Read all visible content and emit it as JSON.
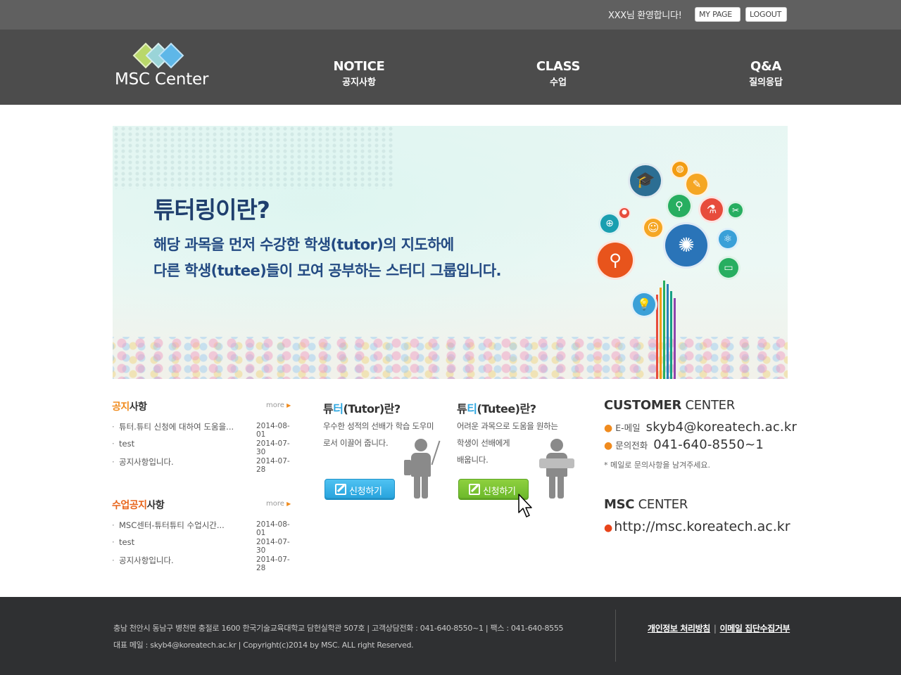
{
  "topbar": {
    "welcome": "XXX님 환영합니다!",
    "mypage_label": "MY PAGE",
    "logout_label": "LOGOUT"
  },
  "header": {
    "logo_text": "MSC Center",
    "nav": [
      {
        "en": "NOTICE",
        "ko": "공지사항"
      },
      {
        "en": "CLASS",
        "ko": "수업"
      },
      {
        "en": "Q&A",
        "ko": "질의응답"
      }
    ]
  },
  "banner": {
    "title": "튜터링이란?",
    "line1": "해당 과목을 먼저 수강한 학생(tutor)의 지도하에",
    "line2": "다른 학생(tutee)들이 모여 공부하는 스터디 그룹입니다."
  },
  "notice": {
    "title_hl": "공지",
    "title_rest": "사항",
    "more_label": "more",
    "items": [
      {
        "text": "튜터.튜티 신청에 대하여 도움을...",
        "date": "2014-08-01"
      },
      {
        "text": "test",
        "date": "2014-07-30"
      },
      {
        "text": "공지사항입니다.",
        "date": "2014-07-28"
      }
    ]
  },
  "class_notice": {
    "title_hl": "수업공지",
    "title_rest": "사항",
    "more_label": "more",
    "items": [
      {
        "text": "MSC센터-튜터튜티 수업시간...",
        "date": "2014-08-01"
      },
      {
        "text": "test",
        "date": "2014-07-30"
      },
      {
        "text": "공지사항입니다.",
        "date": "2014-07-28"
      }
    ]
  },
  "tutor": {
    "title_pre": "튜",
    "title_hl": "터",
    "title_rest": "(Tutor)란?",
    "desc1": "우수한 성적의 선배가 학습 도우미",
    "desc2": "로서 이끌어 줍니다.",
    "button": "신청하기"
  },
  "tutee": {
    "title_pre": "튜",
    "title_hl": "티",
    "title_rest": "(Tutee)란?",
    "desc1": "어려운 과목으로 도움을 원하는",
    "desc2": "학생이 선배에게",
    "desc3": "배웁니다.",
    "button": "신청하기"
  },
  "customer": {
    "title_bold": "CUSTOMER",
    "title_rest": "CENTER",
    "email_label": "E-메일",
    "email": "skyb4@koreatech.ac.kr",
    "phone_label": "문의전화",
    "phone": "041-640-8550~1",
    "note": "*  메일로 문의사항을 남겨주세요."
  },
  "msc": {
    "title_bold": "MSC",
    "title_rest": "CENTER",
    "url": "http://msc.koreatech.ac.kr"
  },
  "footer": {
    "line1": "충남 천안시 동남구 병천면 충절로 1600 한국기술교육대학교 담헌실학관 507호  |  고객상담전화 : 041-640-8550~1  |  팩스 : 041-640-8555",
    "line2": "대표 메일 : skyb4@koreatech.ac.kr  |  Copyright(c)2014 by MSC. ALL right Reserved.",
    "privacy_link": "개인정보 처리방침",
    "email_link": "이메일 집단수집거부"
  },
  "colors": {
    "accent_orange": "#f08b1e",
    "accent_blue": "#2fa7e0",
    "button_blue": "#26a2dc",
    "button_green": "#6bb82a",
    "header_bg": "#4c4c4c",
    "footer_bg": "#2f3032"
  }
}
